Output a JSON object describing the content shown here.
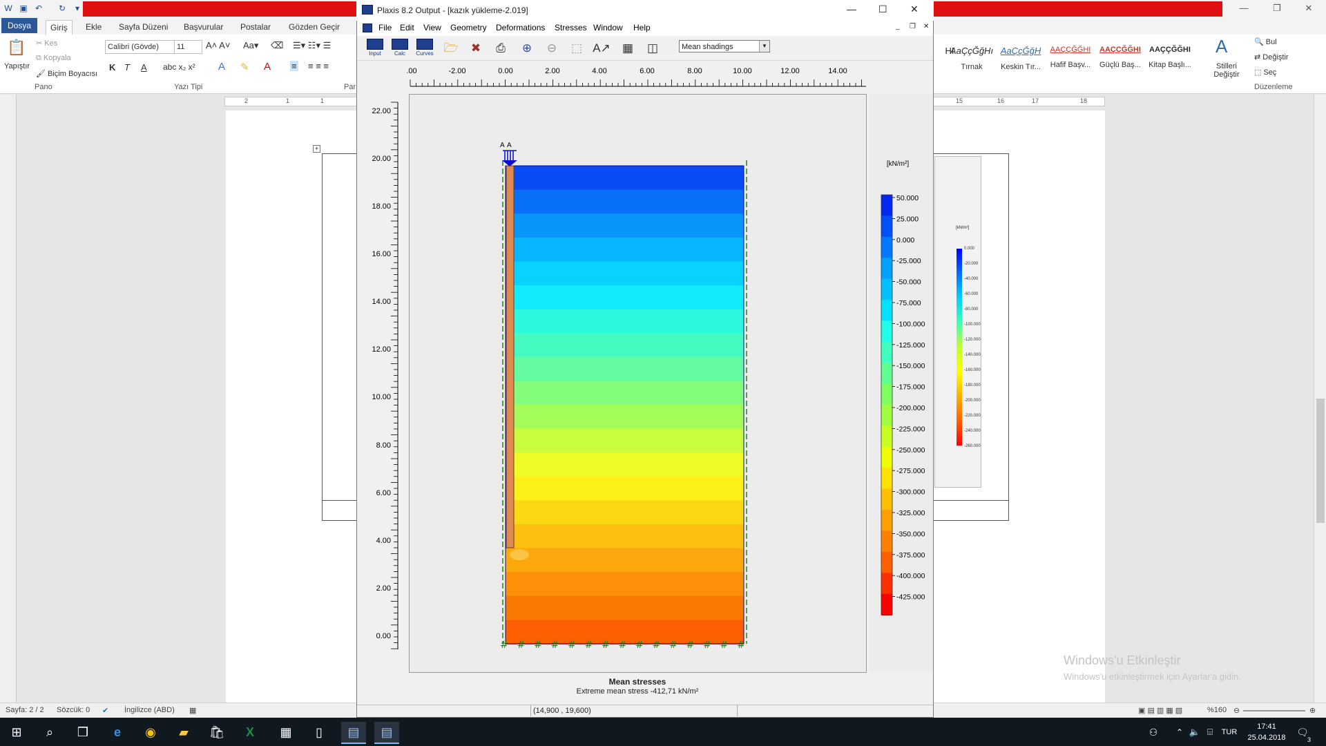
{
  "word": {
    "tabs": [
      "Dosya",
      "Giriş",
      "Ekle",
      "Sayfa Düzeni",
      "Başvurular",
      "Postalar",
      "Gözden Geçir"
    ],
    "clipboard": {
      "paste": "Yapıştır",
      "cut": "Kes",
      "copy": "Kopyala",
      "format_painter": "Biçim Boyacısı",
      "group": "Pano"
    },
    "font": {
      "name": "Calibri (Gövde)",
      "size": "11",
      "group": "Yazı Tipi",
      "bold": "K",
      "italic": "T",
      "underline": "A"
    },
    "paragraph_group": "Par",
    "styles": [
      {
        "sample": "HI",
        "name": ""
      },
      {
        "sample": "AaÇçĞğHı",
        "name": "Tırnak"
      },
      {
        "sample": "AaÇçĞğH",
        "name": "Keskin Tır..."
      },
      {
        "sample": "AAÇÇĞĞHI",
        "name": "Hafif Başv..."
      },
      {
        "sample": "AAÇÇĞĞHI",
        "name": "Güçlü Baş..."
      },
      {
        "sample": "AAÇÇĞĞHI",
        "name": "Kitap Başlı..."
      }
    ],
    "change_styles": "Stilleri Değiştir",
    "editing": {
      "find": "Bul",
      "replace": "Değiştir",
      "select": "Seç",
      "group": "Düzenleme"
    },
    "ruler_numbers": [
      "2",
      "1",
      "1",
      "15",
      "16",
      "17",
      "18"
    ],
    "status": {
      "page": "Sayfa: 2 / 2",
      "words": "Sözcük: 0",
      "language": "İngilizce (ABD)",
      "zoom": "%160"
    },
    "activation": {
      "line1": "Windows'u Etkinleştir",
      "line2": "Windows'u etkinleştirmek için Ayarlar'a gidin."
    },
    "embedded_legend": [
      "0.000",
      "-20.000",
      "-40.000",
      "-60.000",
      "-80.000",
      "-100.000",
      "-120.000",
      "-140.000",
      "-160.000",
      "-180.000",
      "-200.000",
      "-220.000",
      "-240.000",
      "-260.000"
    ],
    "embedded_unit": "[kN/m²]"
  },
  "plaxis": {
    "title": "Plaxis 8.2 Output - [kazık yükleme-2.019]",
    "menu": [
      "File",
      "Edit",
      "View",
      "Geometry",
      "Deformations",
      "Stresses",
      "Window",
      "Help"
    ],
    "toolbar": {
      "input": "Input",
      "calc": "Calc",
      "curves": "Curves"
    },
    "view_select": "Mean shadings",
    "x_ticks": [
      ".00",
      "-2.00",
      "0.00",
      "2.00",
      "4.00",
      "6.00",
      "8.00",
      "10.00",
      "12.00",
      "14.00"
    ],
    "y_ticks": [
      "22.00",
      "20.00",
      "18.00",
      "16.00",
      "14.00",
      "12.00",
      "10.00",
      "8.00",
      "6.00",
      "4.00",
      "2.00",
      "0.00"
    ],
    "point_labels": [
      "A",
      "A"
    ],
    "legend_unit": "[kN/m²]",
    "legend_values": [
      "50.000",
      "25.000",
      "0.000",
      "-25.000",
      "-50.000",
      "-75.000",
      "-100.000",
      "-125.000",
      "-150.000",
      "-175.000",
      "-200.000",
      "-225.000",
      "-250.000",
      "-275.000",
      "-300.000",
      "-325.000",
      "-350.000",
      "-375.000",
      "-400.000",
      "-425.000"
    ],
    "legend_colors": [
      "#0028f0",
      "#0050f8",
      "#0078ff",
      "#00a0ff",
      "#00c0ff",
      "#00e0ff",
      "#20ffe8",
      "#40ffc0",
      "#60ff90",
      "#80ff60",
      "#a0ff40",
      "#c8ff20",
      "#f0ff00",
      "#ffe000",
      "#ffc000",
      "#ffa000",
      "#ff8000",
      "#ff6000",
      "#ff3000",
      "#ff0000"
    ],
    "band_colors": [
      "#0a4cf4",
      "#0870f8",
      "#0896fc",
      "#08b6ff",
      "#08d2ff",
      "#10ecfb",
      "#2cf8e0",
      "#44fcc0",
      "#64fca0",
      "#84fc7c",
      "#a4fc58",
      "#c8fc3c",
      "#ecfc24",
      "#fcf018",
      "#fcd814",
      "#fcc010",
      "#fca80c",
      "#fc9008",
      "#fc7804",
      "#fc6000"
    ],
    "caption_title": "Mean stresses",
    "caption_extreme": "Extreme mean stress -412,71 kN/m²",
    "coords": "(14,900 , 19,600)"
  },
  "taskbar": {
    "time": "17:41",
    "date": "25.04.2018",
    "lang": "TUR",
    "notifications": "3"
  }
}
